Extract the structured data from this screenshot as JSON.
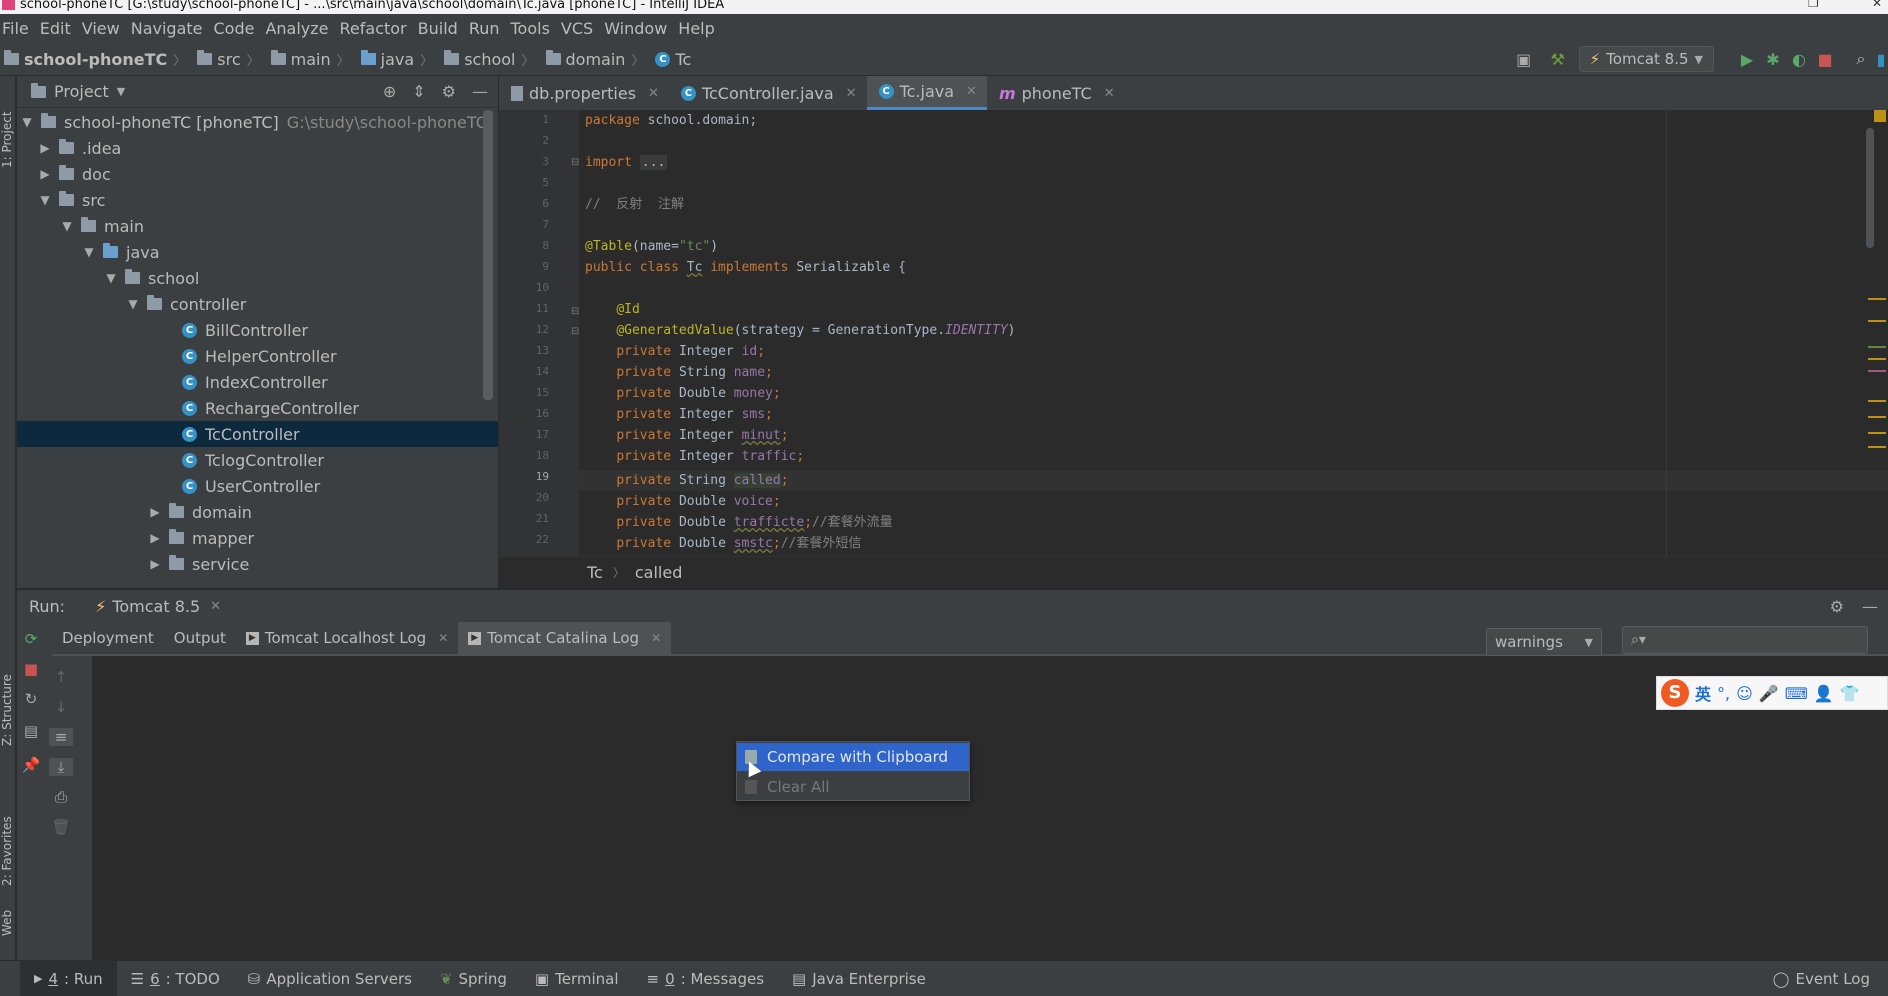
{
  "title_bar": {
    "text": "school-phoneTC [G:\\study\\school-phoneTC] - ...\\src\\main\\java\\school\\domain\\Tc.java [phoneTC] - IntelliJ IDEA"
  },
  "menu": [
    "File",
    "Edit",
    "View",
    "Navigate",
    "Code",
    "Analyze",
    "Refactor",
    "Build",
    "Run",
    "Tools",
    "VCS",
    "Window",
    "Help"
  ],
  "breadcrumbs": [
    "school-phoneTC",
    "src",
    "main",
    "java",
    "school",
    "domain",
    "Tc"
  ],
  "run_config": "Tomcat 8.5",
  "left_strip": {
    "project": "1: Project",
    "structure": "Z: Structure",
    "favorites": "2: Favorites",
    "web": "Web"
  },
  "project_panel": {
    "title": "Project",
    "tree": [
      {
        "label": "school-phoneTC [phoneTC]",
        "path": "G:\\study\\school-phoneTC"
      },
      {
        "label": ".idea"
      },
      {
        "label": "doc"
      },
      {
        "label": "src"
      },
      {
        "label": "main"
      },
      {
        "label": "java"
      },
      {
        "label": "school"
      },
      {
        "label": "controller"
      },
      {
        "label": "BillController"
      },
      {
        "label": "HelperController"
      },
      {
        "label": "IndexController"
      },
      {
        "label": "RechargeController"
      },
      {
        "label": "TcController"
      },
      {
        "label": "TclogController"
      },
      {
        "label": "UserController"
      },
      {
        "label": "domain"
      },
      {
        "label": "mapper"
      },
      {
        "label": "service"
      }
    ]
  },
  "editor_tabs": [
    {
      "label": "db.properties"
    },
    {
      "label": "TcController.java"
    },
    {
      "label": "Tc.java"
    },
    {
      "label": "phoneTC"
    }
  ],
  "code": {
    "line_numbers": [
      "1",
      "2",
      "3",
      "5",
      "6",
      "7",
      "8",
      "9",
      "10",
      "11",
      "12",
      "13",
      "14",
      "15",
      "16",
      "17",
      "18",
      "19",
      "20",
      "21",
      "22"
    ],
    "package_kw": "package",
    "package_name": " school.domain;",
    "import_kw": "import",
    "import_fold": "...",
    "comment": "//  反射  注解",
    "table_ann": "@Table",
    "table_open": "(name=",
    "table_val": "\"tc\"",
    "table_close": ")",
    "class_kw": "public class",
    "class_name": "Tc",
    "implements_kw": "implements",
    "class_rest": " Serializable {",
    "id_ann": "@Id",
    "gen_ann": "@GeneratedValue",
    "gen_args": "(strategy = GenerationType.",
    "gen_const": "IDENTITY",
    "gen_close": ")",
    "private_kw": "private",
    "fields": [
      {
        "type": "Integer",
        "name": "id"
      },
      {
        "type": "String",
        "name": "name"
      },
      {
        "type": "Double",
        "name": "money"
      },
      {
        "type": "Integer",
        "name": "sms"
      },
      {
        "type": "Integer",
        "name": "minut"
      },
      {
        "type": "Integer",
        "name": "traffic"
      },
      {
        "type": "String",
        "name": "called"
      },
      {
        "type": "Double",
        "name": "voice"
      },
      {
        "type": "Double",
        "name": "trafficte",
        "comment": "//套餐外流量"
      },
      {
        "type": "Double",
        "name": "smstc",
        "comment": "//套餐外短信"
      }
    ],
    "semicolon": ";"
  },
  "editor_breadcrumb": [
    "Tc",
    "called"
  ],
  "run_panel": {
    "label": "Run:",
    "tab": "Tomcat 8.5",
    "sub_tabs": [
      "Deployment",
      "Output",
      "Tomcat Localhost Log",
      "Tomcat Catalina Log"
    ],
    "filter_value": "warnings"
  },
  "context_menu": [
    "Compare with Clipboard",
    "Clear All"
  ],
  "ime": {
    "logo": "S",
    "lang": "英"
  },
  "status_bar": [
    {
      "num": "4",
      "label": ": Run"
    },
    {
      "num": "6",
      "label": ": TODO"
    },
    {
      "num": "",
      "label": "Application Servers"
    },
    {
      "num": "",
      "label": "Spring"
    },
    {
      "num": "",
      "label": "Terminal"
    },
    {
      "num": "0",
      "label": ": Messages"
    },
    {
      "num": "",
      "label": "Java Enterprise"
    }
  ],
  "event_log": "Event Log",
  "colors": {
    "selection": "#0d293e",
    "accent": "#4a88c7",
    "menu_highlight": "#2f65ca",
    "keyword": "#cc7832",
    "annotation": "#bbb529",
    "field": "#9876aa"
  }
}
